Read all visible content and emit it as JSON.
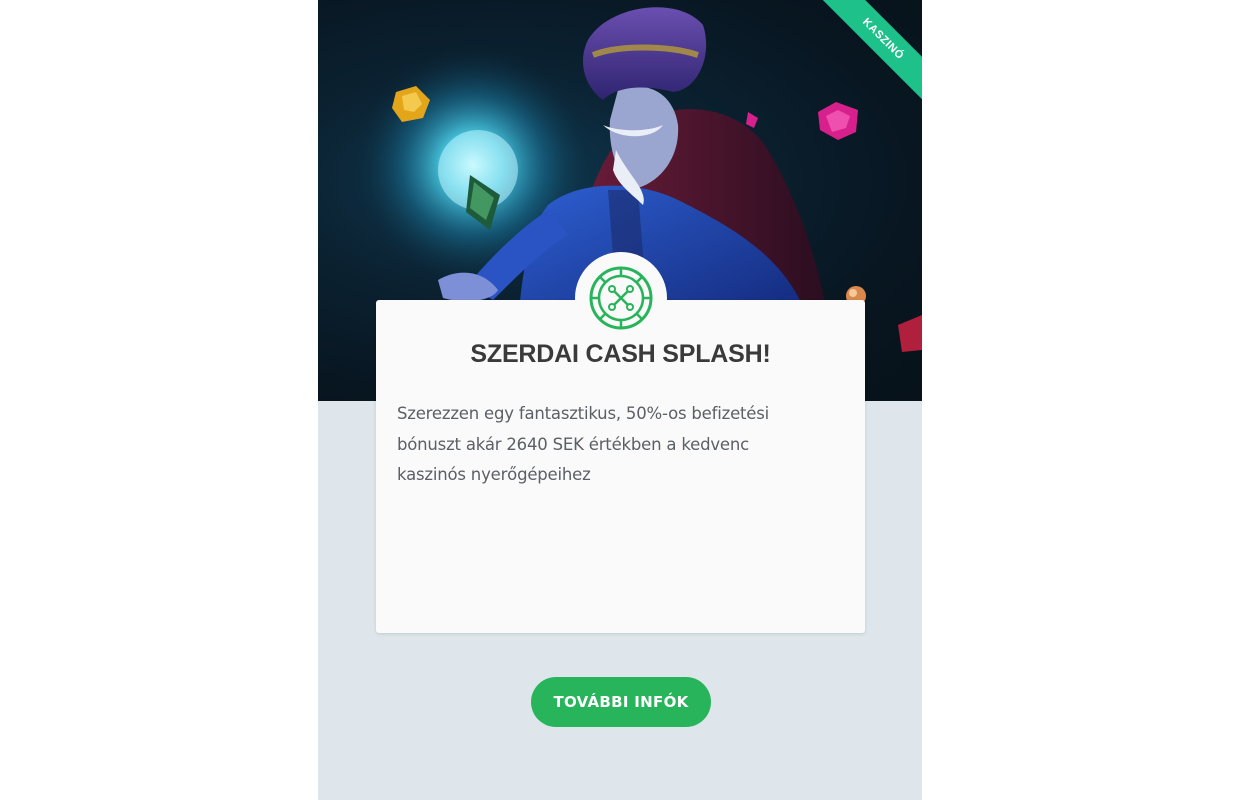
{
  "promo": {
    "category_badge": "KASZINÓ",
    "title": "SZERDAI CASH SPLASH!",
    "description": "Szerezzen egy fantasztikus, 50%-os befizetési bónuszt akár 2640 SEK értékben a kedvenc kaszinós nyerőgépeihez",
    "button_label": "TOVÁBBI INFÓK",
    "icon": "roulette-wheel-icon"
  },
  "colors": {
    "accent_green": "#28b45a",
    "badge_green": "#1fc18a",
    "page_background": "#dee6eb"
  }
}
